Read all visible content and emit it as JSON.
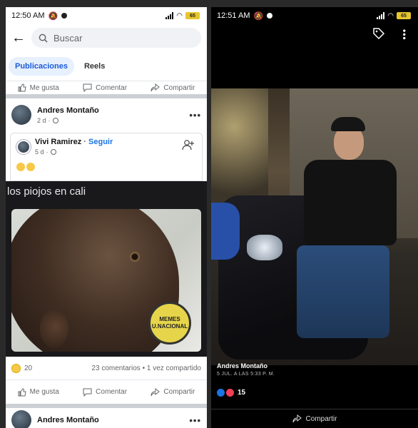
{
  "left": {
    "status": {
      "time": "12:50 AM",
      "battery": "65"
    },
    "search": {
      "placeholder": "Buscar"
    },
    "tabs": [
      {
        "label": "Publicaciones"
      },
      {
        "label": "Reels"
      }
    ],
    "actions": {
      "like": "Me gusta",
      "comment": "Comentar",
      "share": "Compartir"
    },
    "post": {
      "author": "Andres Montaño",
      "time": "2 d",
      "shared_author": "Vivi Ramirez",
      "follow": "Seguir",
      "shared_time": "5 d",
      "text": "los piojos en cali",
      "image_seal": "MEMES U.NACIONAL",
      "reaction_count": "20",
      "stats": "23 comentarios • 1 vez compartido"
    },
    "next_post_author": "Andres Montaño"
  },
  "right": {
    "status": {
      "time": "12:51 AM",
      "battery": "65"
    },
    "caption_name": "Andres Montaño",
    "caption_date": "5 JUL. A LAS 5:33 P. M.",
    "reaction_count": "15",
    "share": "Compartir"
  }
}
